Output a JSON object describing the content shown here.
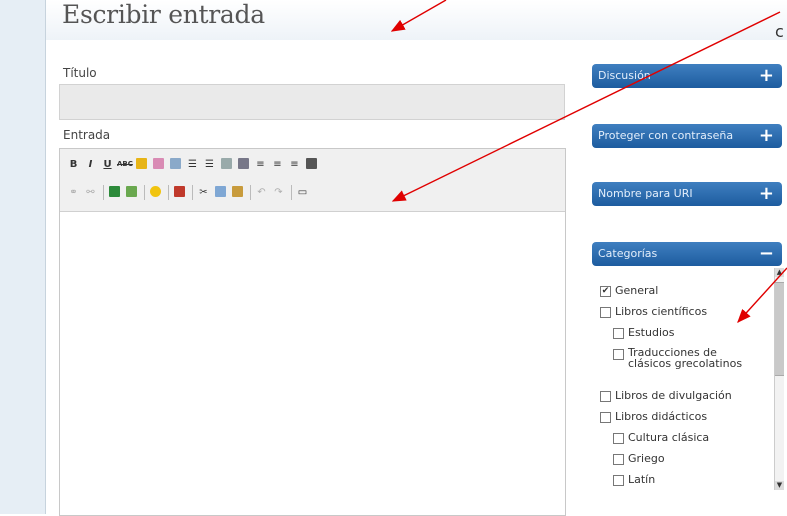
{
  "page_title": "Escribir entrada",
  "edge_char": "c",
  "labels": {
    "titulo": "Título",
    "entrada": "Entrada"
  },
  "toolbar": {
    "row1": [
      "bold",
      "italic",
      "underline",
      "strikethrough",
      "spellcheck",
      "color",
      "align",
      "unordered-list",
      "ordered-list",
      "outdent",
      "indent",
      "align-left",
      "align-center",
      "align-right",
      "align-justify"
    ],
    "row2": [
      "link",
      "unlink",
      "insert-image",
      "insert-media",
      "emoticon",
      "insert-flash",
      "cut",
      "copy",
      "paste",
      "undo",
      "redo",
      "html"
    ],
    "labels": {
      "bold": "B",
      "italic": "I",
      "underline": "U",
      "strike": "ABC"
    }
  },
  "panels": {
    "discussion": "Discusión",
    "password": "Proteger con contraseña",
    "url": "Nombre para URI",
    "categories": "Categorías",
    "plus": "+",
    "minus": "−"
  },
  "categories": [
    {
      "label": "General",
      "checked": true,
      "level": 0
    },
    {
      "label": "Libros científicos",
      "checked": false,
      "level": 0
    },
    {
      "label": "Estudios",
      "checked": false,
      "level": 1
    },
    {
      "label": "Traducciones de clásicos grecolatinos",
      "checked": false,
      "level": 1
    },
    {
      "label": "Libros de divulgación",
      "checked": false,
      "level": 0
    },
    {
      "label": "Libros didácticos",
      "checked": false,
      "level": 0
    },
    {
      "label": "Cultura clásica",
      "checked": false,
      "level": 1
    },
    {
      "label": "Griego",
      "checked": false,
      "level": 1
    },
    {
      "label": "Latín",
      "checked": false,
      "level": 1
    }
  ],
  "colors": {
    "panel_header": "#2466a8",
    "arrow": "#e00000",
    "input_bg": "#eaeaea"
  }
}
